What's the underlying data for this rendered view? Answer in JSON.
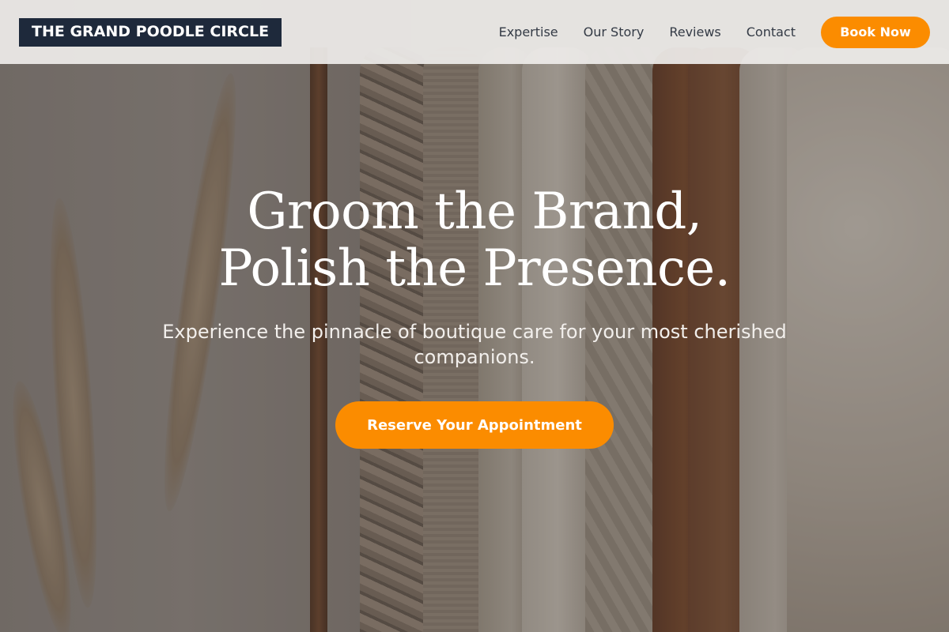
{
  "brand": {
    "logo_text": "THE GRAND POODLE CIRCLE"
  },
  "nav": {
    "links": [
      {
        "label": "Expertise"
      },
      {
        "label": "Our Story"
      },
      {
        "label": "Reviews"
      },
      {
        "label": "Contact"
      }
    ],
    "book_label": "Book Now"
  },
  "hero": {
    "title_line1": "Groom the Brand,",
    "title_line2": "Polish the Presence.",
    "subtitle": "Experience the pinnacle of boutique care for your most cherished companions.",
    "cta_label": "Reserve Your Appointment"
  },
  "colors": {
    "accent": "#fb8c00",
    "logo_bg": "#1e293b",
    "nav_bg": "#eeecea",
    "text_light": "#ffffff"
  }
}
